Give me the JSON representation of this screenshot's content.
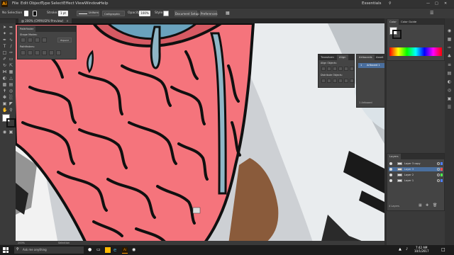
{
  "app": {
    "logo": "Ai"
  },
  "menubar": {
    "items": [
      "File",
      "Edit",
      "Object",
      "Type",
      "Select",
      "Effect",
      "View",
      "Window",
      "Help"
    ],
    "workspace": "Essentials",
    "search_icon": "search-icon"
  },
  "controlbar": {
    "selection": "No Selection",
    "stroke_label": "Stroke:",
    "stroke_value": "1 pt",
    "stroke_profile": "Uniform",
    "brush": "Calligraphic",
    "opacity_label": "Opacity:",
    "opacity_value": "100%",
    "style_label": "Style:",
    "doc_setup": "Document Setup",
    "preferences": "Preferences"
  },
  "document_tab": {
    "title": "@ 200% (CMYK/GPU Preview)"
  },
  "status": {
    "zoom": "200%",
    "label": "Selection"
  },
  "pathfinder": {
    "tab": "Pathfinder",
    "shape_modes": "Shape Modes:",
    "pathfinders": "Pathfinders:",
    "expand": "Expand"
  },
  "align_panel": {
    "tabs": [
      "Transform",
      "Align"
    ],
    "align_objects": "Align Objects:",
    "distribute_objects": "Distribute Objects:"
  },
  "artboards_panel": {
    "tabs": [
      "Artboards",
      "Asset Export"
    ],
    "row": "Artboard 1",
    "footer": "1 Artboard"
  },
  "color_panel": {
    "tabs": [
      "Color",
      "Color Guide"
    ]
  },
  "layers_panel": {
    "tab": "Layers",
    "layers": [
      {
        "name": "Layer 3 copy",
        "color": "#4f7fff"
      },
      {
        "name": "Layer 3",
        "color": "#ff4f4f"
      },
      {
        "name": "Layer 2",
        "color": "#4fff4f"
      },
      {
        "name": "Layer 1",
        "color": "#4f7fff"
      }
    ],
    "footer": "4 Layers"
  },
  "taskbar": {
    "search_placeholder": "Ask me anything",
    "time": "7:42 AM",
    "date": "10/1/2017"
  },
  "colors": {
    "blob_pink": "#f5747c",
    "outline": "#101010",
    "drip_blue": "#8fb6c6",
    "accent_orange": "#ff9a00"
  }
}
